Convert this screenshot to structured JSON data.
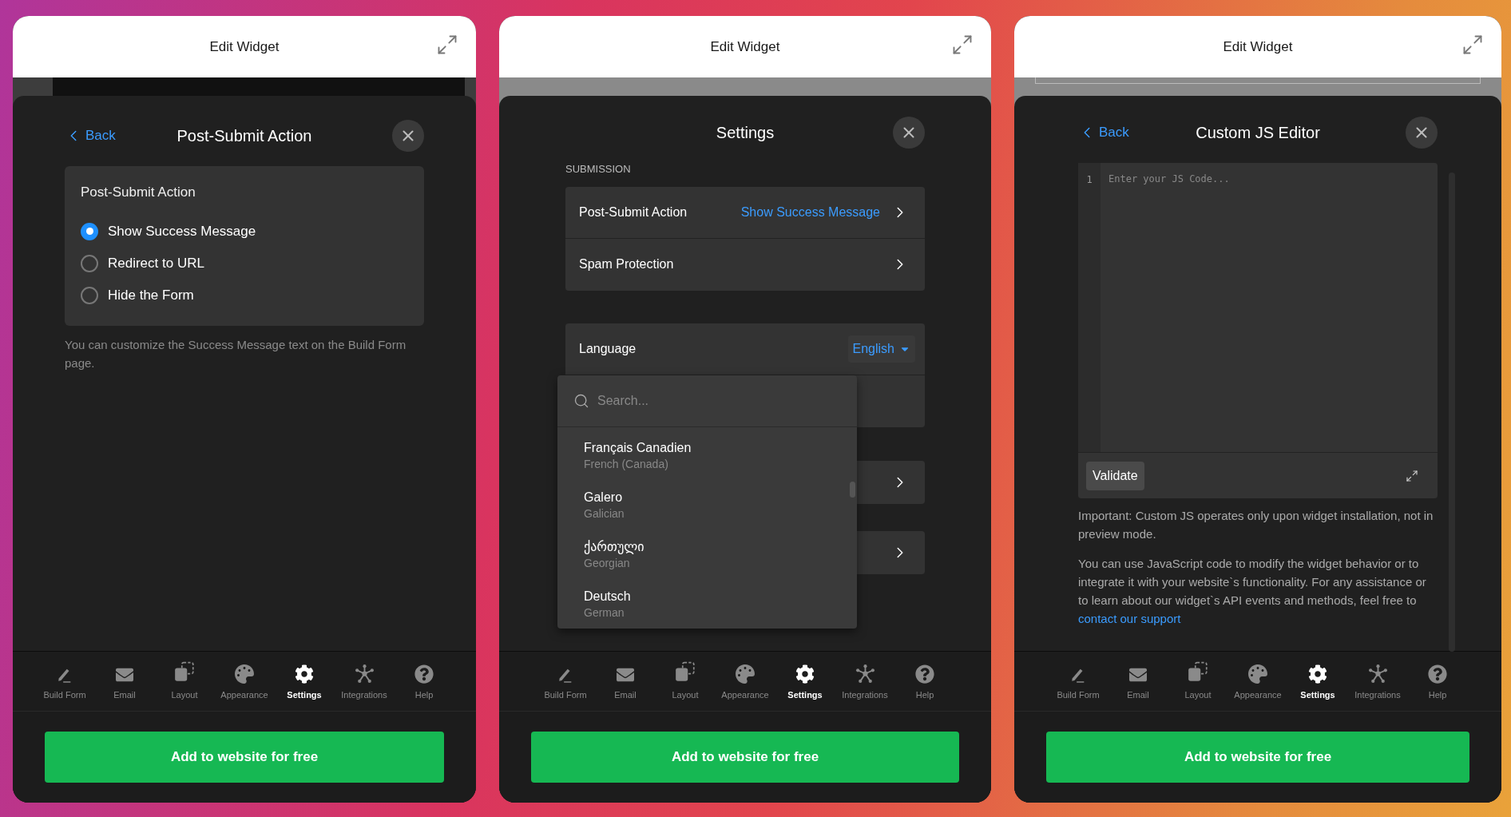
{
  "panels": [
    {
      "kind": "post_submit",
      "window_title": "Edit Widget",
      "back": "Back",
      "title": "Post-Submit Action",
      "card_title": "Post-Submit Action",
      "options": [
        {
          "label": "Show Success Message",
          "selected": true
        },
        {
          "label": "Redirect to URL",
          "selected": false
        },
        {
          "label": "Hide the Form",
          "selected": false
        }
      ],
      "note": "You can customize the Success Message text on the Build Form page.",
      "nav": [
        {
          "label": "Build Form",
          "selected": false
        },
        {
          "label": "Email",
          "selected": false
        },
        {
          "label": "Layout",
          "selected": false
        },
        {
          "label": "Appearance",
          "selected": false
        },
        {
          "label": "Settings",
          "selected": true
        },
        {
          "label": "Integrations",
          "selected": false
        },
        {
          "label": "Help",
          "selected": false
        }
      ],
      "cta": "Add to website for free"
    },
    {
      "kind": "settings",
      "window_title": "Edit Widget",
      "title": "Settings",
      "section": "SUBMISSION",
      "rows": [
        {
          "label": "Post-Submit Action",
          "value": "Show Success Message"
        },
        {
          "label": "Spam Protection"
        }
      ],
      "language": {
        "label": "Language",
        "value": "English"
      },
      "dropdown": {
        "placeholder": "Search...",
        "options": [
          {
            "name": "Français Canadien",
            "english": "French (Canada)"
          },
          {
            "name": "Galero",
            "english": "Galician"
          },
          {
            "name": "ქართული",
            "english": "Georgian"
          },
          {
            "name": "Deutsch",
            "english": "German"
          }
        ]
      },
      "nav": [
        {
          "label": "Build Form",
          "selected": false
        },
        {
          "label": "Email",
          "selected": false
        },
        {
          "label": "Layout",
          "selected": false
        },
        {
          "label": "Appearance",
          "selected": false
        },
        {
          "label": "Settings",
          "selected": true
        },
        {
          "label": "Integrations",
          "selected": false
        },
        {
          "label": "Help",
          "selected": false
        }
      ],
      "cta": "Add to website for free"
    },
    {
      "kind": "js_editor",
      "window_title": "Edit Widget",
      "back": "Back",
      "title": "Custom JS Editor",
      "line_number": "1",
      "placeholder": "Enter your JS Code...",
      "validate": "Validate",
      "note": "Important: Custom JS operates only upon widget installation, not in preview mode.",
      "help_text": "You can use JavaScript code to modify the widget behavior or to integrate it with your website`s functionality. For any assistance or to learn about our widget`s API events and methods, feel free to ",
      "help_link": "contact our support",
      "nav": [
        {
          "label": "Build Form",
          "selected": false
        },
        {
          "label": "Email",
          "selected": false
        },
        {
          "label": "Layout",
          "selected": false
        },
        {
          "label": "Appearance",
          "selected": false
        },
        {
          "label": "Settings",
          "selected": true
        },
        {
          "label": "Integrations",
          "selected": false
        },
        {
          "label": "Help",
          "selected": false
        }
      ],
      "cta": "Add to website for free"
    }
  ]
}
